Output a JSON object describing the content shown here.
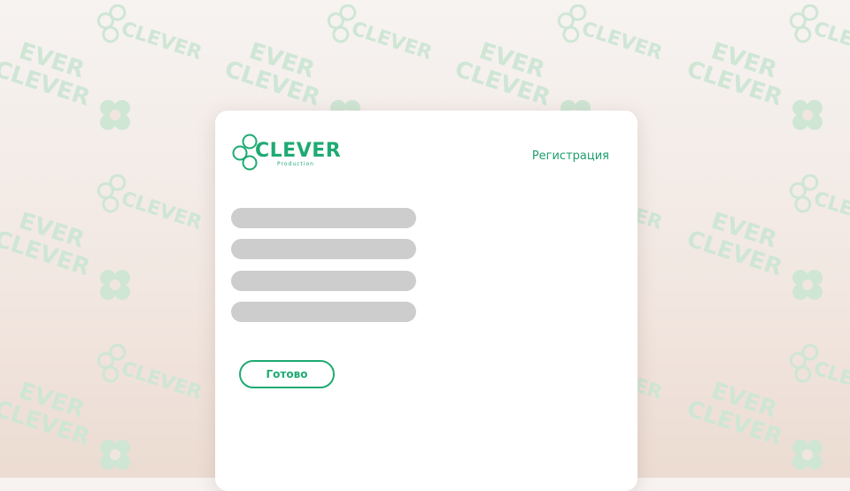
{
  "background": {
    "watermark_lines": [
      "EVER",
      "CLEVER"
    ],
    "watermark_color": "#cfe6d5"
  },
  "logo": {
    "word": "CLEVER",
    "subtitle": "Production",
    "color": "#1faa73"
  },
  "header": {
    "register_label": "Регистрация"
  },
  "form": {
    "fields": [
      {
        "value": "",
        "placeholder": ""
      },
      {
        "value": "",
        "placeholder": ""
      },
      {
        "value": "",
        "placeholder": ""
      },
      {
        "value": "",
        "placeholder": ""
      }
    ],
    "submit_label": "Готово"
  },
  "colors": {
    "accent": "#1faa73",
    "field_fill": "#cdcdcd",
    "card": "#ffffff"
  }
}
